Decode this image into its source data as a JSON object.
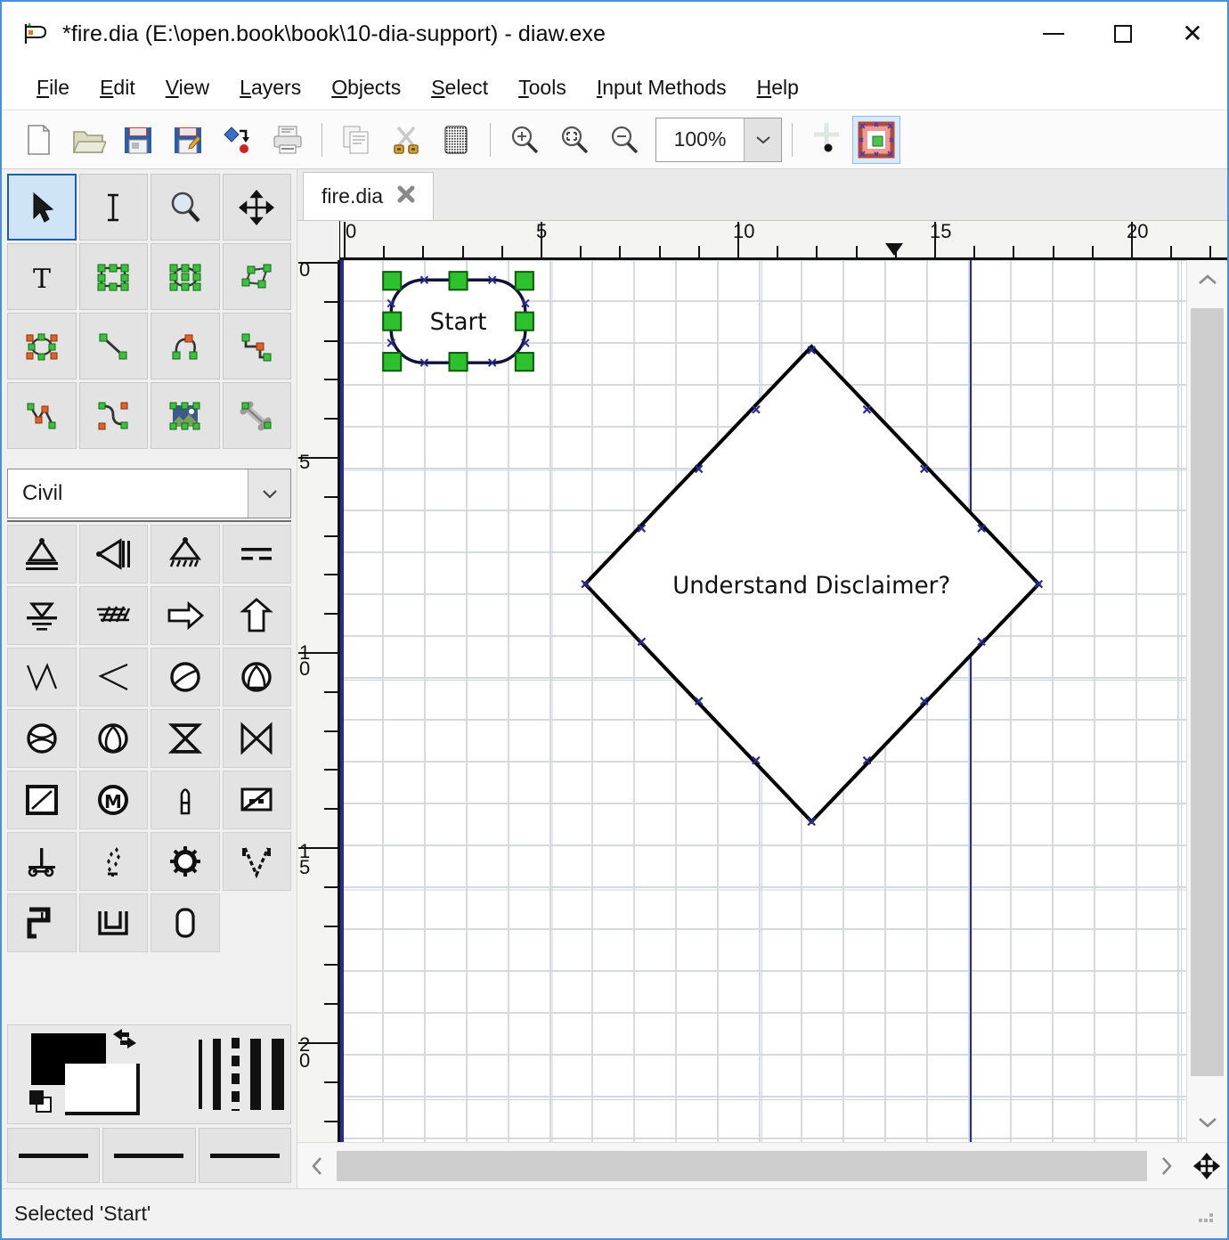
{
  "window": {
    "title": "*fire.dia (E:\\open.book\\book\\10-dia-support) - diaw.exe",
    "app_icon": "dia-logo-icon",
    "minimize": "—",
    "maximize": "□",
    "close": "✕"
  },
  "menubar": {
    "items": [
      {
        "label": "File",
        "mnemonic": "F"
      },
      {
        "label": "Edit",
        "mnemonic": "E"
      },
      {
        "label": "View",
        "mnemonic": "V"
      },
      {
        "label": "Layers",
        "mnemonic": "L"
      },
      {
        "label": "Objects",
        "mnemonic": "O"
      },
      {
        "label": "Select",
        "mnemonic": "S"
      },
      {
        "label": "Tools",
        "mnemonic": "T"
      },
      {
        "label": "Input Methods",
        "mnemonic": "I"
      },
      {
        "label": "Help",
        "mnemonic": "H"
      }
    ]
  },
  "toolbar": {
    "buttons": [
      {
        "name": "new-icon",
        "tip": "New"
      },
      {
        "name": "open-folder-icon",
        "tip": "Open"
      },
      {
        "name": "save-icon",
        "tip": "Save"
      },
      {
        "name": "save-as-icon",
        "tip": "Save As"
      },
      {
        "name": "export-icon",
        "tip": "Export"
      },
      {
        "name": "print-icon",
        "tip": "Print"
      },
      {
        "name": "copy-icon",
        "tip": "Copy"
      },
      {
        "name": "cut-scissors-icon",
        "tip": "Cut"
      },
      {
        "name": "paste-icon",
        "tip": "Paste"
      },
      {
        "name": "zoom-in-icon",
        "tip": "Zoom In"
      },
      {
        "name": "zoom-fit-icon",
        "tip": "Zoom Fit"
      },
      {
        "name": "zoom-out-icon",
        "tip": "Zoom Out"
      }
    ],
    "zoom_value": "100%",
    "zoom_dropdown_icon": "chevron-down-icon",
    "snap_to_grid_icon": "snap-to-grid-icon",
    "snap_to_objects_icon": "snap-to-objects-icon"
  },
  "toolbox": {
    "tools": [
      {
        "name": "pointer-tool",
        "selected": true
      },
      {
        "name": "text-edit-tool",
        "selected": false
      },
      {
        "name": "magnify-tool",
        "selected": false
      },
      {
        "name": "scroll-tool",
        "selected": false
      },
      {
        "name": "text-tool",
        "selected": false
      },
      {
        "name": "box-tool",
        "selected": false
      },
      {
        "name": "ellipse-tool",
        "selected": false
      },
      {
        "name": "polygon-tool",
        "selected": false
      },
      {
        "name": "beziergon-tool",
        "selected": false
      },
      {
        "name": "line-tool",
        "selected": false
      },
      {
        "name": "arc-tool",
        "selected": false
      },
      {
        "name": "zigzagline-tool",
        "selected": false
      },
      {
        "name": "polyline-tool",
        "selected": false
      },
      {
        "name": "bezierline-tool",
        "selected": false
      },
      {
        "name": "image-tool",
        "selected": false
      },
      {
        "name": "outline-tool",
        "selected": false
      }
    ],
    "sheet": {
      "selected": "Civil",
      "dropdown_icon": "chevron-down-icon"
    },
    "shapes": [
      {
        "name": "civil-bearing-icon"
      },
      {
        "name": "civil-vertical-channel-icon"
      },
      {
        "name": "civil-horizontal-limiting-line-icon"
      },
      {
        "name": "civil-reference-line-icon"
      },
      {
        "name": "civil-water-level-icon"
      },
      {
        "name": "civil-soil-layers-icon"
      },
      {
        "name": "civil-arrow-right-icon"
      },
      {
        "name": "civil-arrow-up-icon"
      },
      {
        "name": "civil-gradient-icon"
      },
      {
        "name": "civil-angle-icon"
      },
      {
        "name": "civil-aerator-icon"
      },
      {
        "name": "civil-rotor-icon"
      },
      {
        "name": "civil-frequency-converter-icon"
      },
      {
        "name": "civil-preliminary-clarification-icon"
      },
      {
        "name": "civil-container-icon"
      },
      {
        "name": "civil-final-clarification-icon"
      },
      {
        "name": "civil-basin-icon"
      },
      {
        "name": "civil-motor-icon"
      },
      {
        "name": "civil-vertical-propeller-icon"
      },
      {
        "name": "civil-backflow-preventer-icon"
      },
      {
        "name": "civil-vertical-rest-icon"
      },
      {
        "name": "civil-aerator-fine-icon"
      },
      {
        "name": "civil-gear-pump-icon"
      },
      {
        "name": "civil-v-channel-icon"
      },
      {
        "name": "civil-retention-basin-icon"
      },
      {
        "name": "civil-u-channel-icon"
      },
      {
        "name": "civil-rotary-cylinder-icon"
      }
    ],
    "style": {
      "fg_color": "#000000",
      "bg_color": "#ffffff",
      "swap_icon": "swap-colors-icon",
      "reset_icon": "default-colors-icon",
      "line_widths": [
        "thin",
        "medium",
        "dashed",
        "thick",
        "extra-thick"
      ],
      "line_style_buttons": [
        "line-style-solid",
        "line-style-arrow-start",
        "line-style-arrow-end"
      ]
    }
  },
  "canvas": {
    "tab": {
      "label": "fire.dia",
      "close_icon": "close-icon"
    },
    "hruler": {
      "labels": [
        "0",
        "5",
        "10",
        "15",
        "20"
      ],
      "marker_position": "14",
      "unit": "cm"
    },
    "vruler": {
      "labels": [
        "0",
        "5",
        "10",
        "15",
        "20"
      ],
      "unit": "cm"
    },
    "page_boundaries": [
      "left",
      "right"
    ],
    "grid": {
      "minor_color": "#cfd4d8",
      "major_color": "#c6d8e4",
      "background": "#ffffff"
    },
    "objects": [
      {
        "name": "start-terminal-shape",
        "type": "rounded-rect",
        "label": "Start",
        "selected": true,
        "handle_color": "#2ec12e",
        "connection_color": "#2b2b8f",
        "stroke": "#111133"
      },
      {
        "name": "decision-diamond-shape",
        "type": "diamond",
        "label": "Understand Disclaimer?",
        "selected": false,
        "connection_color": "#2b2b8f",
        "stroke": "#000000"
      }
    ],
    "vscroll": {
      "up_icon": "chevron-up-icon",
      "down_icon": "chevron-down-icon"
    },
    "hscroll": {
      "left_icon": "chevron-left-icon",
      "right_icon": "chevron-right-icon"
    },
    "corner_icon": "move-cross-icon"
  },
  "statusbar": {
    "message": "Selected 'Start'",
    "grip_icon": "resize-grip-icon"
  }
}
